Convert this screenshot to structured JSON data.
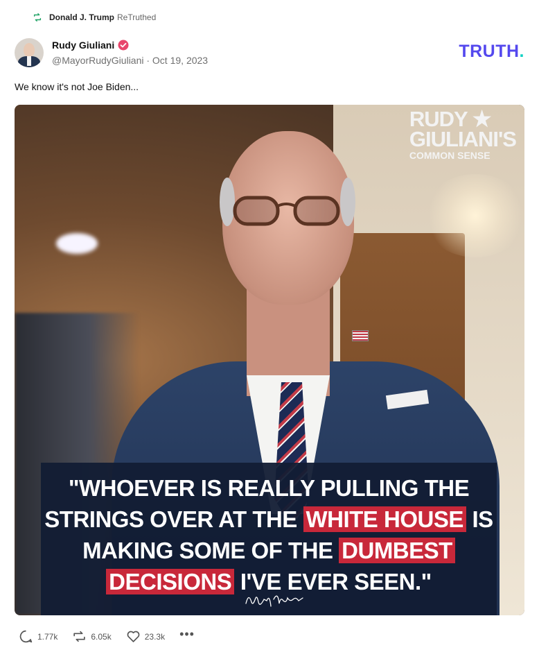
{
  "retruth": {
    "user": "Donald J. Trump",
    "label": "ReTruthed",
    "icon": "retruth-icon"
  },
  "author": {
    "name": "Rudy Giuliani",
    "handle_line": "@MayorRudyGiuliani · Oct 19, 2023",
    "verified_icon": "verified-badge-icon",
    "avatar": "avatar"
  },
  "brand_logo": {
    "main": "TRUTH",
    "dot": "."
  },
  "post": {
    "text": "We know it's not Joe Biden..."
  },
  "media": {
    "brand_lines": [
      "RUDY ★",
      "GIULIANI'S",
      "COMMON SENSE"
    ],
    "quote": {
      "l1": "\"WHOEVER IS REALLY PULLING THE",
      "l2a": "STRINGS OVER AT THE ",
      "l2b": "WHITE HOUSE",
      "l2c": " IS",
      "l3a": "MAKING SOME OF THE ",
      "l3b": "DUMBEST",
      "l4a": "DECISIONS",
      "l4b": " I'VE EVER SEEN.\""
    },
    "highlight_color": "#c8283a"
  },
  "actions": {
    "replies": "1.77k",
    "retruths": "6.05k",
    "likes": "23.3k",
    "more": "•••"
  },
  "colors": {
    "accent": "#5448ee",
    "accent_dot": "#0fd1c3",
    "retruth_green": "#21a366",
    "verified": "#e8466c"
  }
}
